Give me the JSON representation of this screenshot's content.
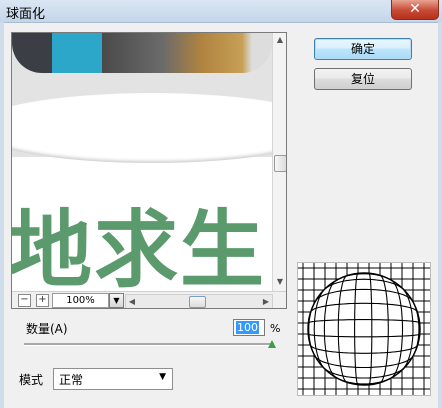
{
  "window": {
    "title": "球面化",
    "close_glyph": "✕"
  },
  "preview": {
    "text": "地求生",
    "zoom": {
      "minus": "−",
      "plus": "+",
      "value": "100%"
    }
  },
  "buttons": {
    "ok": "确定",
    "reset": "复位"
  },
  "amount": {
    "label": "数量(A)",
    "value": "100",
    "unit": "%",
    "slider_fraction": 1.0
  },
  "mode": {
    "label": "模式",
    "selected": "正常"
  },
  "colors": {
    "accent": "#3399ff",
    "text_green": "#5b9a6d",
    "close_red": "#c74a35"
  },
  "icons": [
    "close-icon",
    "scroll-up-icon",
    "scroll-down-icon",
    "scroll-left-icon",
    "scroll-right-icon",
    "chevron-down-icon",
    "sphere-grid-icon"
  ]
}
